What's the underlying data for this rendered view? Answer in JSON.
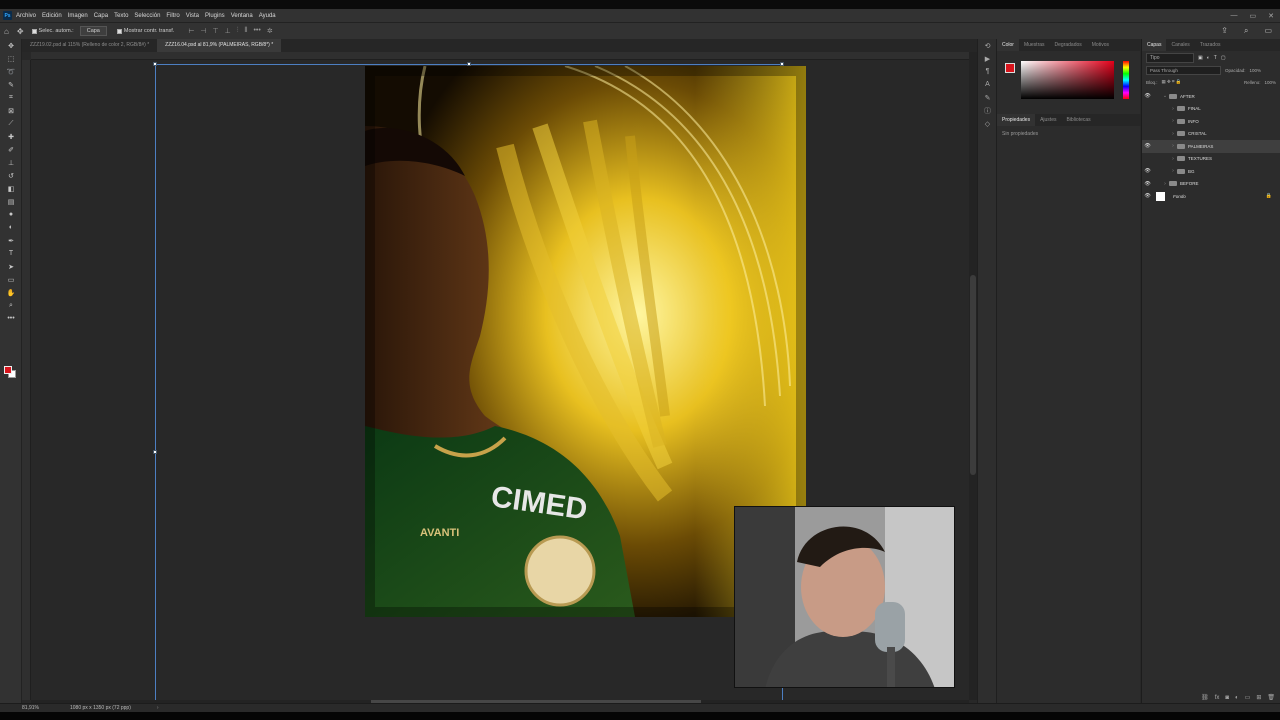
{
  "app": {
    "icon_label": "Ps"
  },
  "menu": [
    "Archivo",
    "Edición",
    "Imagen",
    "Capa",
    "Texto",
    "Selección",
    "Filtro",
    "Vista",
    "Plugins",
    "Ventana",
    "Ayuda"
  ],
  "window_controls": [
    "—",
    "▭",
    "✕"
  ],
  "options": {
    "autoselect_label": "Selec. autom.:",
    "autoselect_value": "Capa",
    "transform_label": "Mostrar contr. transf."
  },
  "tabs": [
    {
      "label": "ZZZ19.02.psd al 115% (Relleno de color 2, RGB/8#) *",
      "active": false
    },
    {
      "label": "ZZZ16.04.psd al 81,9% (PALMEIRAS, RGB/8*) *",
      "active": true
    }
  ],
  "status": {
    "zoom": "81,91%",
    "doc_info": "1080 px x 1350 px (72 ppp)"
  },
  "color_panel": {
    "tabs": [
      "Color",
      "Muestras",
      "Degradados",
      "Motivos"
    ],
    "fg_color": "#d8141c",
    "bg_color": "#ffffff"
  },
  "properties_panel": {
    "tabs": [
      "Propiedades",
      "Ajustes",
      "Bibliotecas"
    ],
    "empty_text": "Sin propiedades"
  },
  "layers_panel": {
    "tabs": [
      "Capas",
      "Canales",
      "Trazados"
    ],
    "filter_value": "Tipo",
    "blend_mode": "Pass Through",
    "opacity_label": "Opacidad:",
    "opacity_value": "100%",
    "lock_label": "Bloq.:",
    "fill_label": "Relleno:",
    "fill_value": "100%",
    "layers": [
      {
        "name": "AFTER",
        "visible": true,
        "indent": 1,
        "expanded": true,
        "selected": false
      },
      {
        "name": "FINAL",
        "visible": false,
        "indent": 2,
        "expanded": false,
        "selected": false
      },
      {
        "name": "INFO",
        "visible": false,
        "indent": 2,
        "expanded": false,
        "selected": false
      },
      {
        "name": "CRISTAL",
        "visible": false,
        "indent": 2,
        "expanded": false,
        "selected": false
      },
      {
        "name": "PALMEIRAS",
        "visible": true,
        "indent": 2,
        "expanded": false,
        "selected": true
      },
      {
        "name": "TEXTURES",
        "visible": false,
        "indent": 2,
        "expanded": false,
        "selected": false
      },
      {
        "name": "BG",
        "visible": true,
        "indent": 2,
        "expanded": false,
        "selected": false
      },
      {
        "name": "BEFORE",
        "visible": true,
        "indent": 1,
        "expanded": false,
        "selected": false
      },
      {
        "name": "Fondo",
        "visible": true,
        "indent": 0,
        "expanded": false,
        "selected": false,
        "locked": true
      }
    ]
  },
  "artwork": {
    "jersey_text": "CIMED",
    "patch_text": "AVANTI"
  }
}
